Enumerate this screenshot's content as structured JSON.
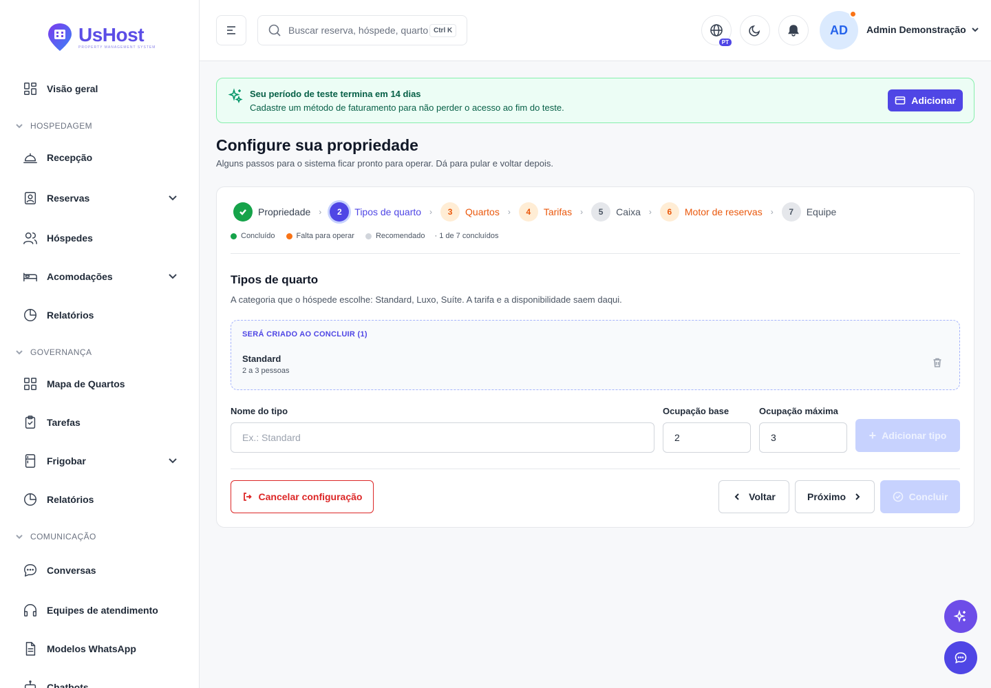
{
  "brand": {
    "name": "UsHost",
    "tagline": "PROPERTY MANAGEMENT SYSTEM"
  },
  "sidebar": {
    "top_item": "Visão geral",
    "sections": [
      {
        "title": "HOSPEDAGEM",
        "items": [
          {
            "label": "Recepção",
            "icon": "bell-desk-icon"
          },
          {
            "label": "Reservas",
            "icon": "reservation-icon",
            "expandable": true
          },
          {
            "label": "Hóspedes",
            "icon": "users-icon"
          },
          {
            "label": "Acomodações",
            "icon": "bed-icon",
            "expandable": true
          },
          {
            "label": "Relatórios",
            "icon": "pie-chart-icon"
          }
        ]
      },
      {
        "title": "GOVERNANÇA",
        "items": [
          {
            "label": "Mapa de Quartos",
            "icon": "grid-icon"
          },
          {
            "label": "Tarefas",
            "icon": "clipboard-check-icon"
          },
          {
            "label": "Frigobar",
            "icon": "fridge-icon",
            "expandable": true
          },
          {
            "label": "Relatórios",
            "icon": "pie-chart-icon"
          }
        ]
      },
      {
        "title": "COMUNICAÇÃO",
        "items": [
          {
            "label": "Conversas",
            "icon": "chat-bubble-icon"
          },
          {
            "label": "Equipes de atendimento",
            "icon": "headset-icon"
          },
          {
            "label": "Modelos WhatsApp",
            "icon": "document-icon"
          },
          {
            "label": "Chatbots",
            "icon": "bot-icon"
          }
        ]
      }
    ]
  },
  "topbar": {
    "search_placeholder": "Buscar reserva, hóspede, quarto",
    "search_shortcut": "Ctrl K",
    "language_badge": "PT",
    "avatar_initials": "AD",
    "user_name": "Admin Demonstração"
  },
  "banner": {
    "title": "Seu período de teste termina em 14 dias",
    "text": "Cadastre um método de faturamento para não perder o acesso ao fim do teste.",
    "button": "Adicionar"
  },
  "page": {
    "title": "Configure sua propriedade",
    "subtitle": "Alguns passos para o sistema ficar pronto para operar. Dá para pular e voltar depois."
  },
  "wizard": {
    "steps": [
      {
        "num": "1",
        "label": "Propriedade",
        "state": "done"
      },
      {
        "num": "2",
        "label": "Tipos de quarto",
        "state": "active"
      },
      {
        "num": "3",
        "label": "Quartos",
        "state": "missing"
      },
      {
        "num": "4",
        "label": "Tarifas",
        "state": "missing"
      },
      {
        "num": "5",
        "label": "Caixa",
        "state": "rec"
      },
      {
        "num": "6",
        "label": "Motor de reservas",
        "state": "missing"
      },
      {
        "num": "7",
        "label": "Equipe",
        "state": "rec"
      }
    ],
    "legend": {
      "done": "Concluído",
      "missing": "Falta para operar",
      "recommended": "Recomendado",
      "progress": "· 1 de 7 concluídos"
    },
    "section_title": "Tipos de quarto",
    "section_subtitle": "A categoria que o hóspede escolhe: Standard, Luxo, Suíte. A tarifa e a disponibilidade saem daqui.",
    "pending_header": "SERÁ CRIADO AO CONCLUIR (1)",
    "pending_items": [
      {
        "name": "Standard",
        "capacity": "2 a 3 pessoas"
      }
    ],
    "form": {
      "name_label": "Nome do tipo",
      "name_placeholder": "Ex.: Standard",
      "base_label": "Ocupação base",
      "base_value": "2",
      "max_label": "Ocupação máxima",
      "max_value": "3",
      "add_button": "Adicionar tipo"
    },
    "buttons": {
      "cancel": "Cancelar configuração",
      "back": "Voltar",
      "next": "Próximo",
      "finish": "Concluir"
    }
  },
  "colors": {
    "accent": "#4f46e5",
    "success": "#16a34a",
    "warning": "#f97316",
    "danger": "#dc2626",
    "fab_ai": "#6d4de8",
    "fab_chat": "#4f46e5"
  }
}
